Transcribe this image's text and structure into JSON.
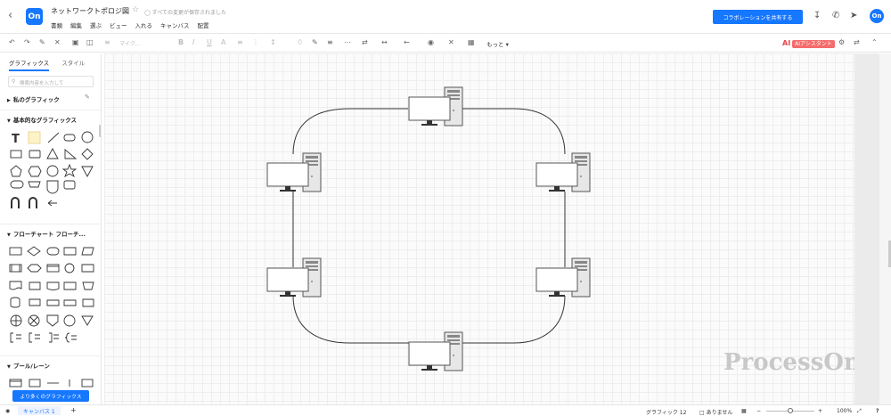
{
  "header": {
    "logo_text": "On",
    "doc_title": "ネットワークトポロジ図",
    "save_status": "すべての変更が保存されました",
    "menus": [
      "書類",
      "編集",
      "選ぶ",
      "ビュー",
      "入れる",
      "キャンバス",
      "配置"
    ],
    "collab_button": "コラボレーションを共有する",
    "avatar_text": "On"
  },
  "toolbar": {
    "font_name": "マイク...",
    "font_size": "",
    "more": "もっと",
    "ai_label": "AI",
    "ai_badge": "AIアシスタント"
  },
  "sidebar": {
    "tabs": [
      "グラフィックス",
      "スタイル"
    ],
    "search_placeholder": "検索内容を入力して",
    "sections": [
      {
        "label": "私のグラフィック"
      },
      {
        "label": "基本的なグラフィックス"
      },
      {
        "label": "フローチャート フローチ..."
      },
      {
        "label": "プール/レーン"
      }
    ],
    "more_button": "より多くのグラフィックス"
  },
  "canvas": {
    "watermark": "ProcessOn",
    "nodes": [
      {
        "name": "pc-top"
      },
      {
        "name": "pc-upper-left"
      },
      {
        "name": "pc-upper-right"
      },
      {
        "name": "pc-lower-left"
      },
      {
        "name": "pc-lower-right"
      },
      {
        "name": "pc-bottom"
      }
    ]
  },
  "statusbar": {
    "page_tab": "キャンバス 1",
    "add_page": "+",
    "shape_count": "グラフィック 12",
    "focus_mode": "ありません",
    "zoom": "100%"
  },
  "colors": {
    "accent": "#1677ff",
    "ai_badge": "#f56c6c",
    "grid": "#eeeeee"
  }
}
